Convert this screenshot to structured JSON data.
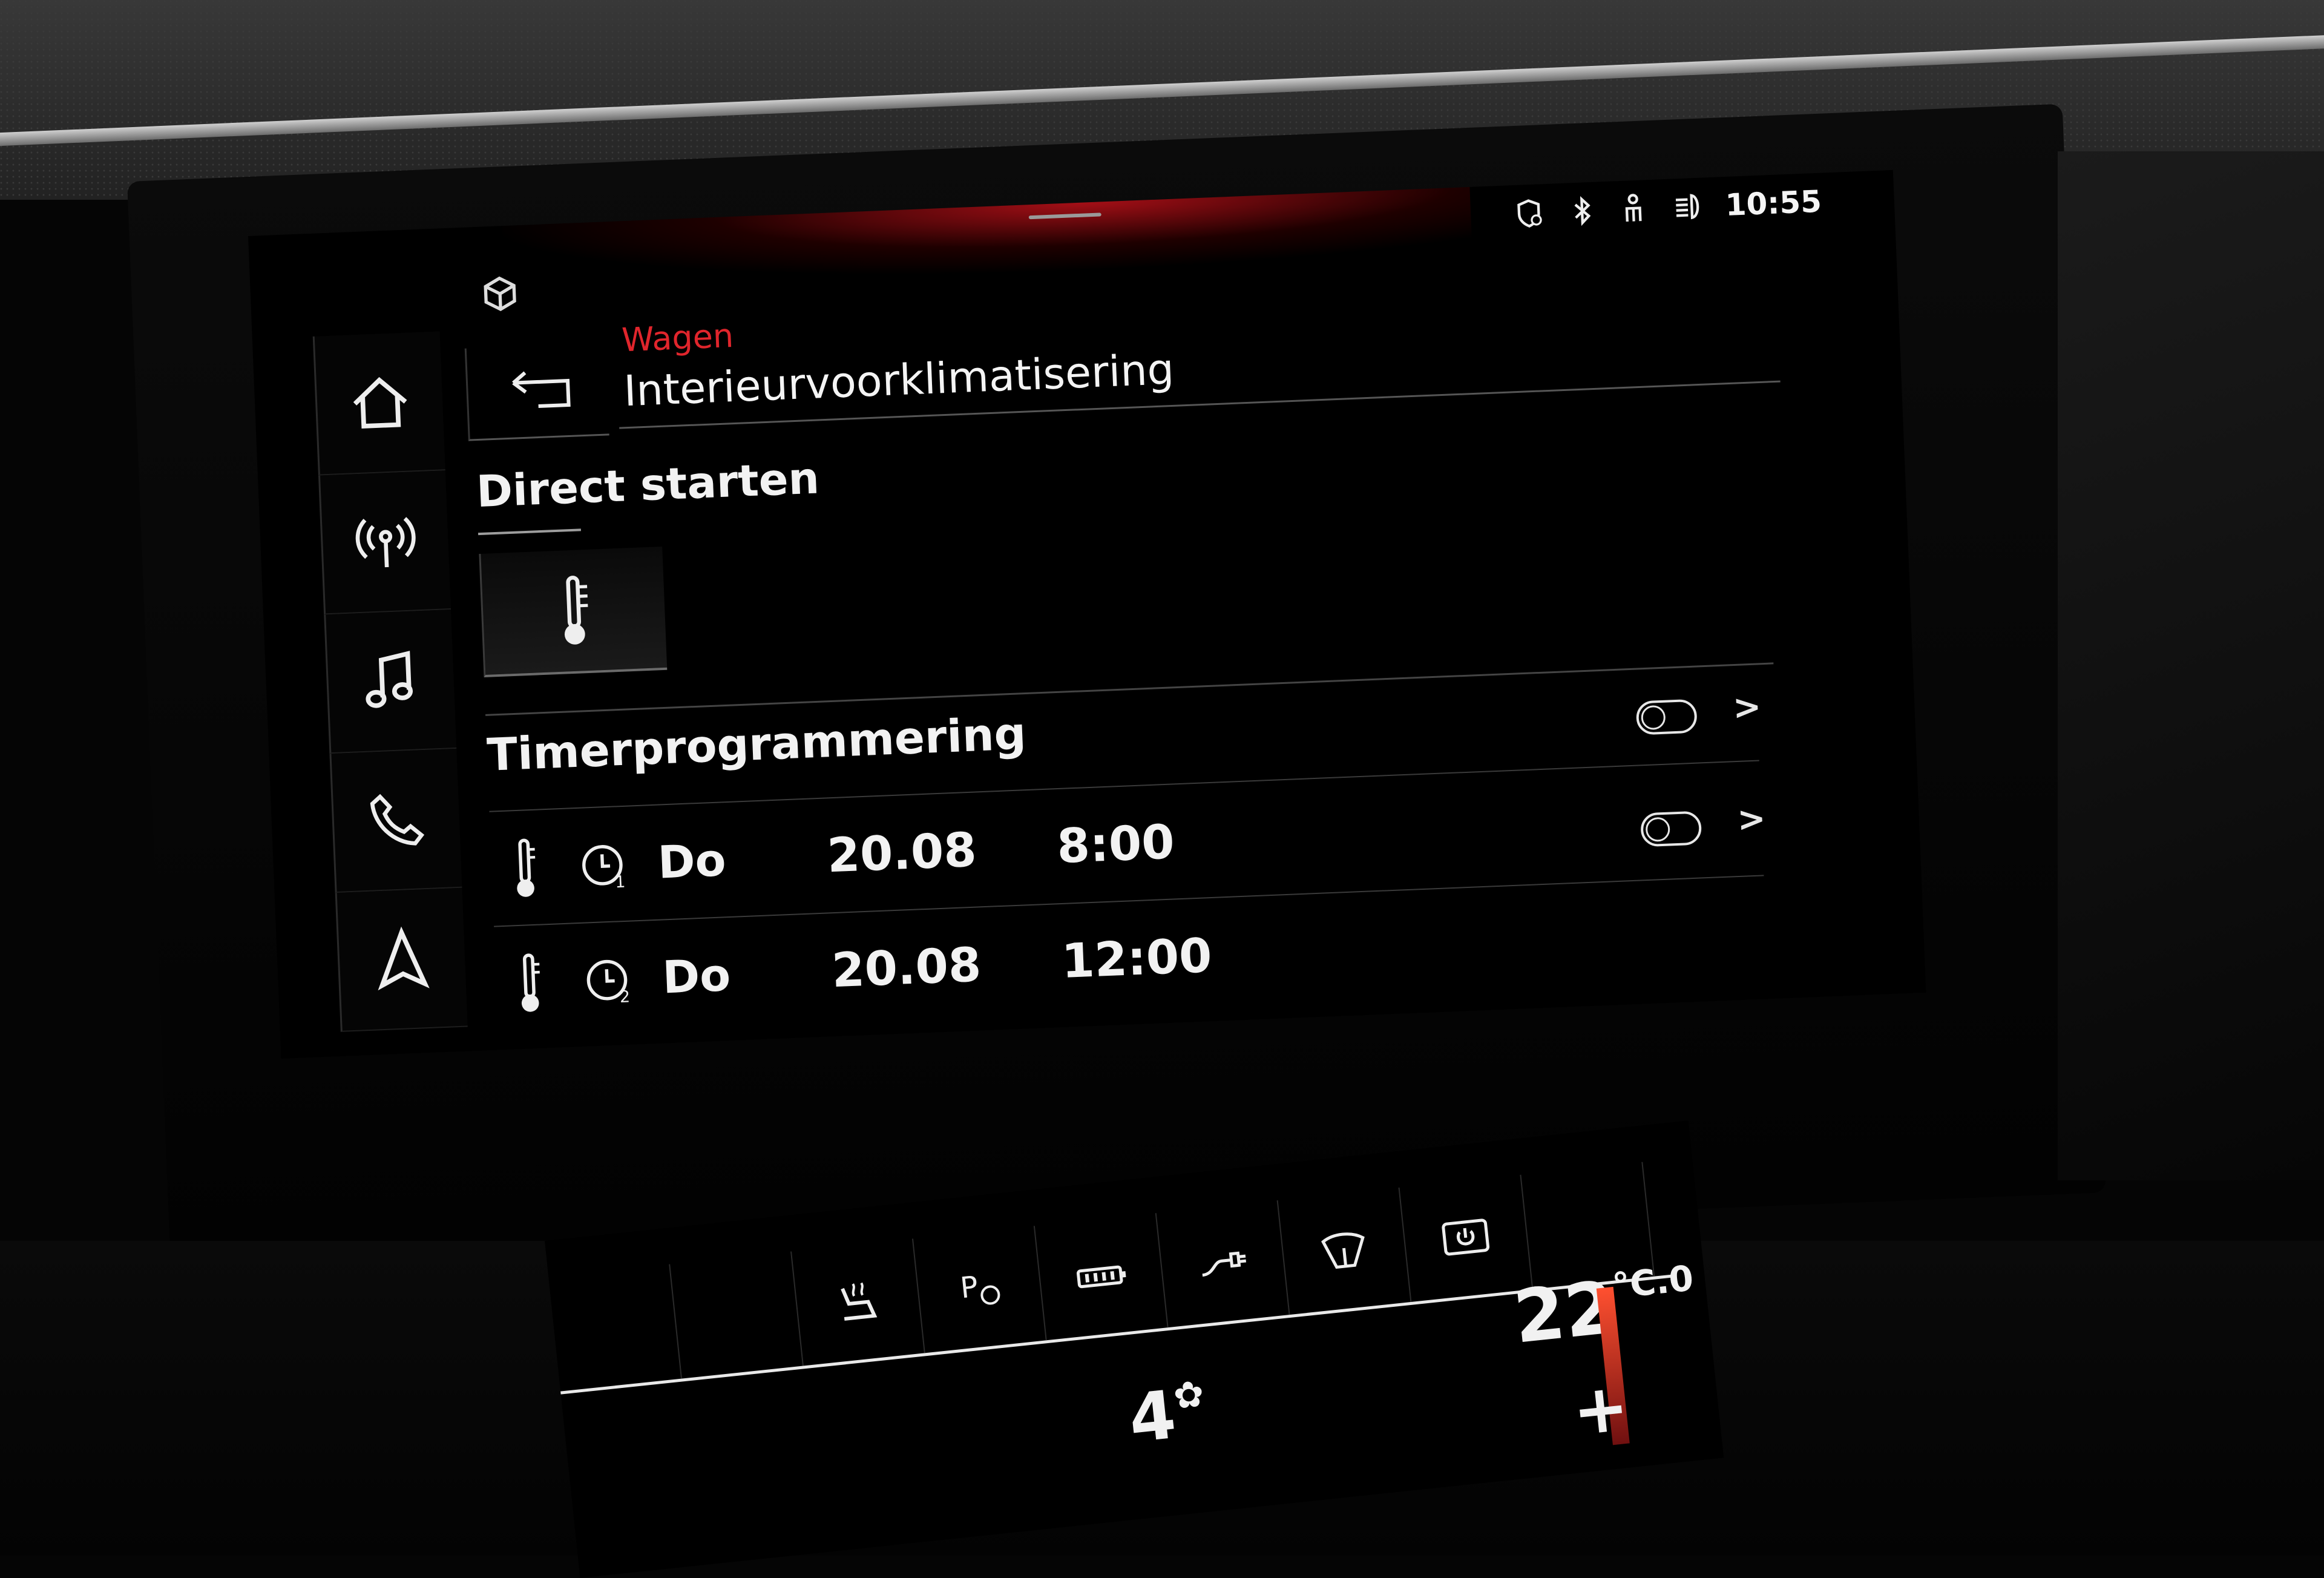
{
  "status_bar": {
    "icons": [
      "location-shield-icon",
      "bluetooth-icon",
      "passenger-airbag-icon",
      "headlight-assist-icon"
    ],
    "time": "10:55"
  },
  "header": {
    "breadcrumb": "Wagen",
    "title": "Interieurvoorklimatisering"
  },
  "sidebar": {
    "items": [
      {
        "name": "home",
        "icon": "home-icon"
      },
      {
        "name": "radio",
        "icon": "radio-antenna-icon"
      },
      {
        "name": "media",
        "icon": "music-note-icon"
      },
      {
        "name": "phone",
        "icon": "phone-icon"
      },
      {
        "name": "navigation",
        "icon": "navigation-arrow-icon"
      }
    ]
  },
  "direct_start": {
    "label": "Direct starten",
    "button_icon": "thermometer-icon"
  },
  "timer": {
    "label": "Timerprogrammering",
    "rows": [
      {
        "timer_no": "1",
        "day": "Do",
        "date": "20.08",
        "time": "8:00"
      },
      {
        "timer_no": "2",
        "day": "Do",
        "date": "20.08",
        "time": "12:00"
      }
    ]
  },
  "climate_panel": {
    "fan_level": "4",
    "temperature": "22",
    "temperature_decimal": ".0",
    "temperature_unit": "°C",
    "increase_label": "+",
    "buttons": [
      "seat-heating-icon",
      "parking-sensor-icon",
      "battery-icon",
      "charge-plug-icon",
      "rear-wiper-icon",
      "power-icon"
    ]
  },
  "colors": {
    "accent_red": "#e0252c",
    "text": "#f4f4f4",
    "background": "#000000"
  }
}
